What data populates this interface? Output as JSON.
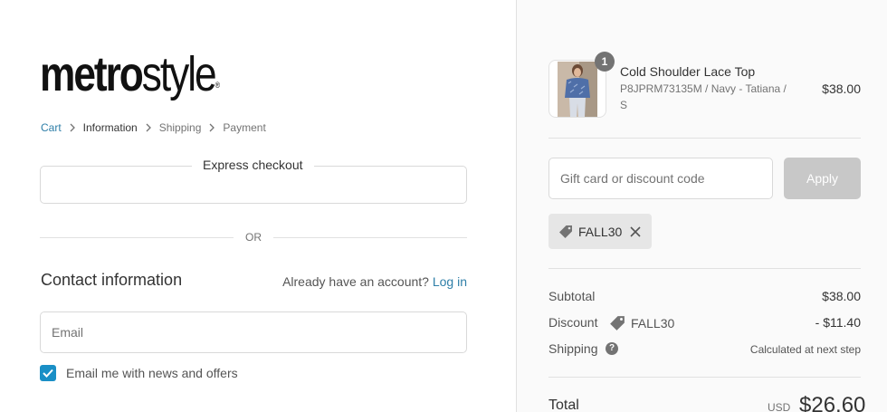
{
  "brand": {
    "bold": "metro",
    "light": "style",
    "reg": "®"
  },
  "breadcrumb": {
    "items": [
      {
        "label": "Cart"
      },
      {
        "label": "Information"
      },
      {
        "label": "Shipping"
      },
      {
        "label": "Payment"
      }
    ]
  },
  "express": {
    "title": "Express checkout",
    "or_label": "OR"
  },
  "contact": {
    "title": "Contact information",
    "account_prompt": "Already have an account?",
    "login_label": "Log in",
    "email_placeholder": "Email",
    "newsletter_label": "Email me with news and offers",
    "newsletter_checked": true
  },
  "cart": {
    "item": {
      "quantity": "1",
      "name": "Cold Shoulder Lace Top",
      "variant": "P8JPRM73135M / Navy - Tatiana / S",
      "price": "$38.00"
    },
    "discount_placeholder": "Gift card or discount code",
    "apply_label": "Apply",
    "applied_code": "FALL30"
  },
  "summary": {
    "subtotal_label": "Subtotal",
    "subtotal_value": "$38.00",
    "discount_label": "Discount",
    "discount_code": "FALL30",
    "discount_value": "- $11.40",
    "shipping_label": "Shipping",
    "shipping_value": "Calculated at next step",
    "help_glyph": "?",
    "total_label": "Total",
    "total_currency": "USD",
    "total_value": "$26.60"
  },
  "colors": {
    "link": "#2f7fa8",
    "checkbox": "#1a8fc6",
    "sidebar_bg": "#fafafa",
    "apply_disabled": "#c8c8c8"
  },
  "icons": {
    "breadcrumb_separator": "chevron-right-icon",
    "checkbox": "checkmark-icon",
    "discount": "tag-icon",
    "remove": "close-icon",
    "shipping_help": "question-circle-icon"
  }
}
